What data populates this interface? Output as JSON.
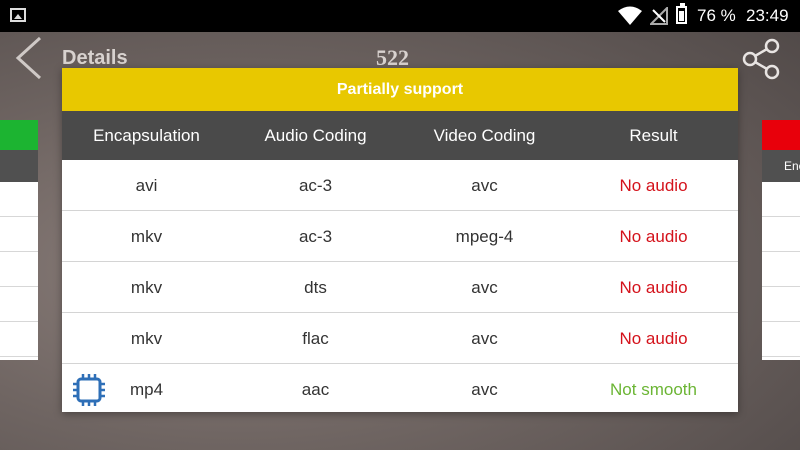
{
  "status_bar": {
    "battery_percent": "76 %",
    "time": "23:49",
    "icons": [
      "image-notification-icon",
      "wifi-icon",
      "no-signal-icon",
      "battery-icon"
    ]
  },
  "header": {
    "title": "Details",
    "count": "522"
  },
  "side_cards": {
    "right_header_text": "Enc"
  },
  "dialog": {
    "title": "Partially support",
    "accent_color": "#e8c800",
    "columns": [
      "Encapsulation",
      "Audio Coding",
      "Video Coding",
      "Result"
    ],
    "rows": [
      {
        "encapsulation": "avi",
        "audio": "ac-3",
        "video": "avc",
        "result": "No audio"
      },
      {
        "encapsulation": "mkv",
        "audio": "ac-3",
        "video": "mpeg-4",
        "result": "No audio"
      },
      {
        "encapsulation": "mkv",
        "audio": "dts",
        "video": "avc",
        "result": "No audio"
      },
      {
        "encapsulation": "mkv",
        "audio": "flac",
        "video": "avc",
        "result": "No audio"
      },
      {
        "encapsulation": "mp4",
        "audio": "aac",
        "video": "avc",
        "result": "Not smooth"
      }
    ],
    "result_colors": {
      "No audio": "#d4121b",
      "Not smooth": "#6bb534"
    }
  }
}
